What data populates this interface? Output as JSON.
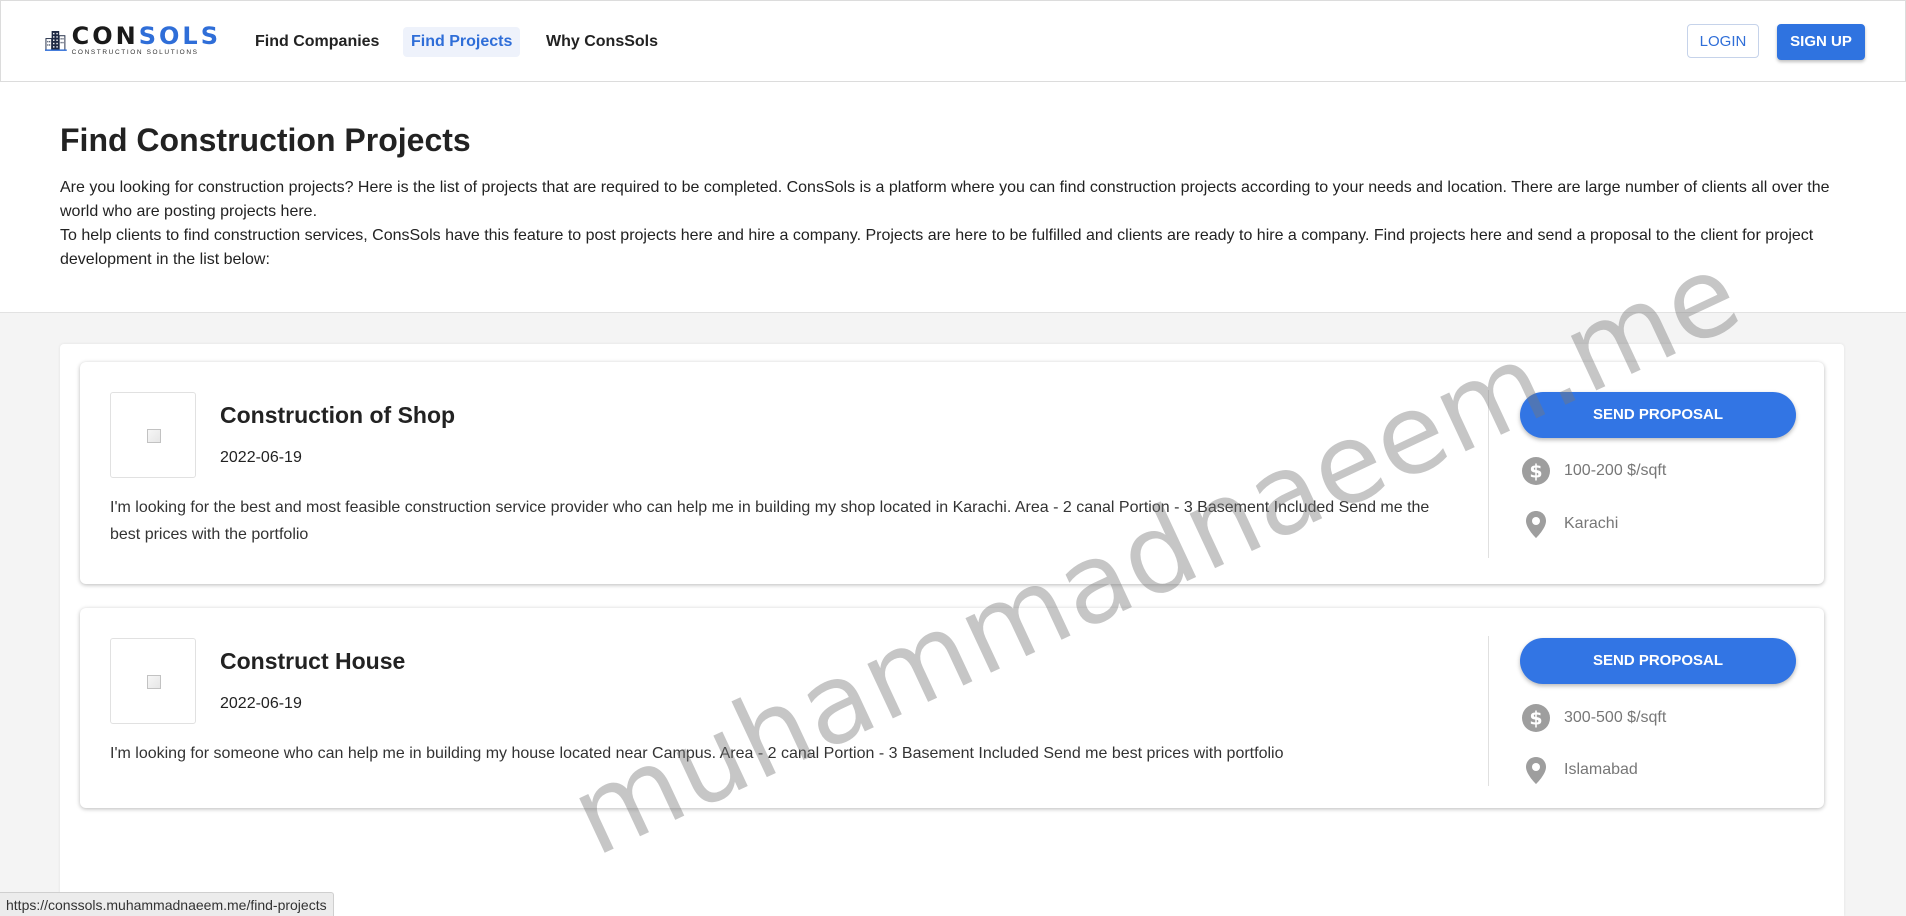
{
  "header": {
    "logo": {
      "word_start": "CON",
      "word_accent": "SOLS",
      "tagline": "CONSTRUCTION SOLUTIONS"
    },
    "nav": [
      {
        "label": "Find Companies",
        "active": false
      },
      {
        "label": "Find Projects",
        "active": true
      },
      {
        "label": "Why ConsSols",
        "active": false
      }
    ],
    "login_label": "LOGIN",
    "signup_label": "SIGN UP"
  },
  "intro": {
    "title": "Find Construction Projects",
    "paragraph_1": "Are you looking for construction projects? Here is the list of projects that are required to be completed. ConsSols is a platform where you can find construction projects according to your needs and location. There are large number of clients all over the world who are posting projects here.",
    "paragraph_2": "To help clients to find construction services, ConsSols have this feature to post projects here and hire a company. Projects are here to be fulfilled and clients are ready to hire a company. Find projects here and send a proposal to the client for project development in the list below:"
  },
  "projects": [
    {
      "title": "Construction of Shop",
      "date": "2022-06-19",
      "description": "I'm looking for the best and most feasible construction service provider who can help me in building my shop located in Karachi. Area - 2 canal Portion - 3 Basement Included Send me the best prices with the portfolio",
      "button_label": "SEND PROPOSAL",
      "price": "100-200 $/sqft",
      "location": "Karachi"
    },
    {
      "title": "Construct House",
      "date": "2022-06-19",
      "description": "I'm looking for someone who can help me in building my house located near Campus. Area - 2 canal Portion - 3 Basement Included Send me best prices with portfolio",
      "button_label": "SEND PROPOSAL",
      "price": "300-500 $/sqft",
      "location": "Islamabad"
    }
  ],
  "watermark": "muhammadnaeem.me",
  "status_url": "https://conssols.muhammadnaeem.me/find-projects",
  "icons": {
    "price": "dollar-circle-icon",
    "location": "map-pin-icon",
    "thumbnail": "broken-image-icon"
  },
  "colors": {
    "accent": "#2f73e0",
    "icon_gray": "#9e9e9e"
  }
}
